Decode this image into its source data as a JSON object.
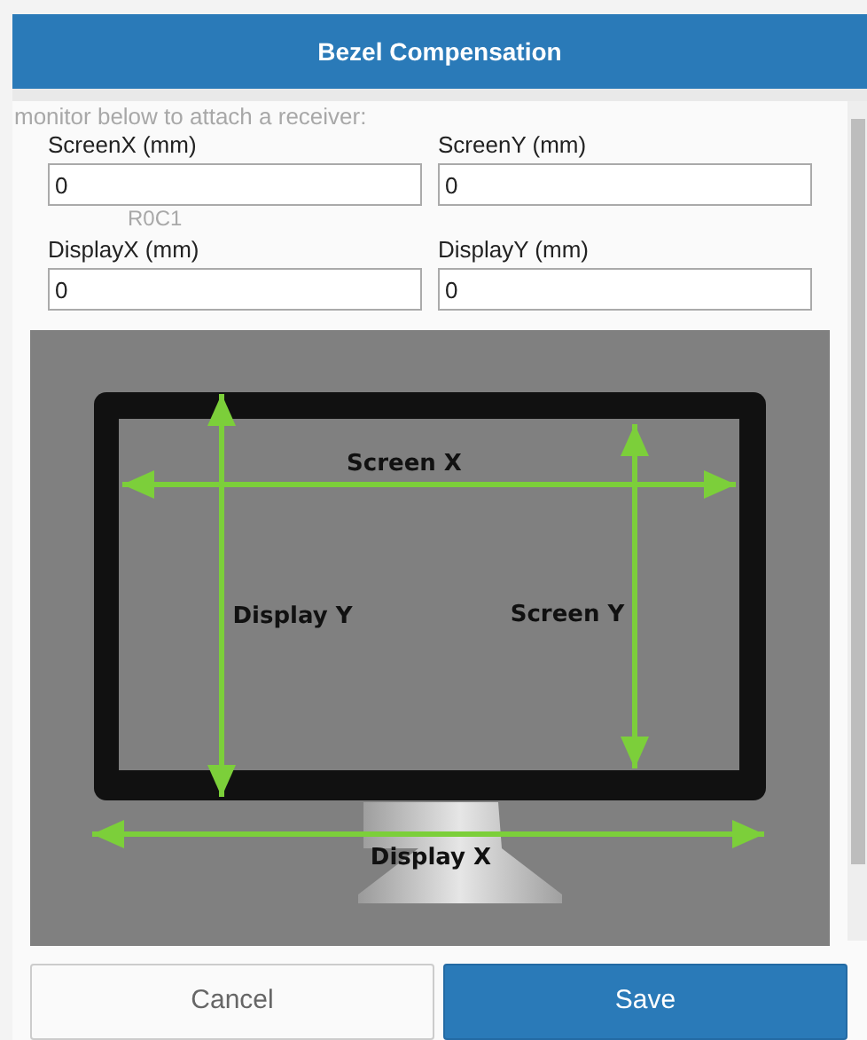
{
  "dialog": {
    "title": "Bezel Compensation"
  },
  "background_text": "monitor below to attach a receiver:",
  "background_cell": "R0C1",
  "fields": [
    {
      "label": "ScreenX (mm)",
      "value": "0"
    },
    {
      "label": "ScreenY (mm)",
      "value": "0"
    },
    {
      "label": "DisplayX (mm)",
      "value": "0"
    },
    {
      "label": "DisplayY (mm)",
      "value": "0"
    }
  ],
  "diagram": {
    "labels": [
      {
        "kind": "screen_x",
        "text": "Screen X"
      },
      {
        "kind": "display_y",
        "text": "Display Y"
      },
      {
        "kind": "screen_y",
        "text": "Screen Y"
      },
      {
        "kind": "display_x",
        "text": "Display X"
      }
    ]
  },
  "buttons": [
    {
      "kind": "secondary",
      "label": "Cancel"
    },
    {
      "kind": "primary",
      "label": "Save"
    }
  ]
}
